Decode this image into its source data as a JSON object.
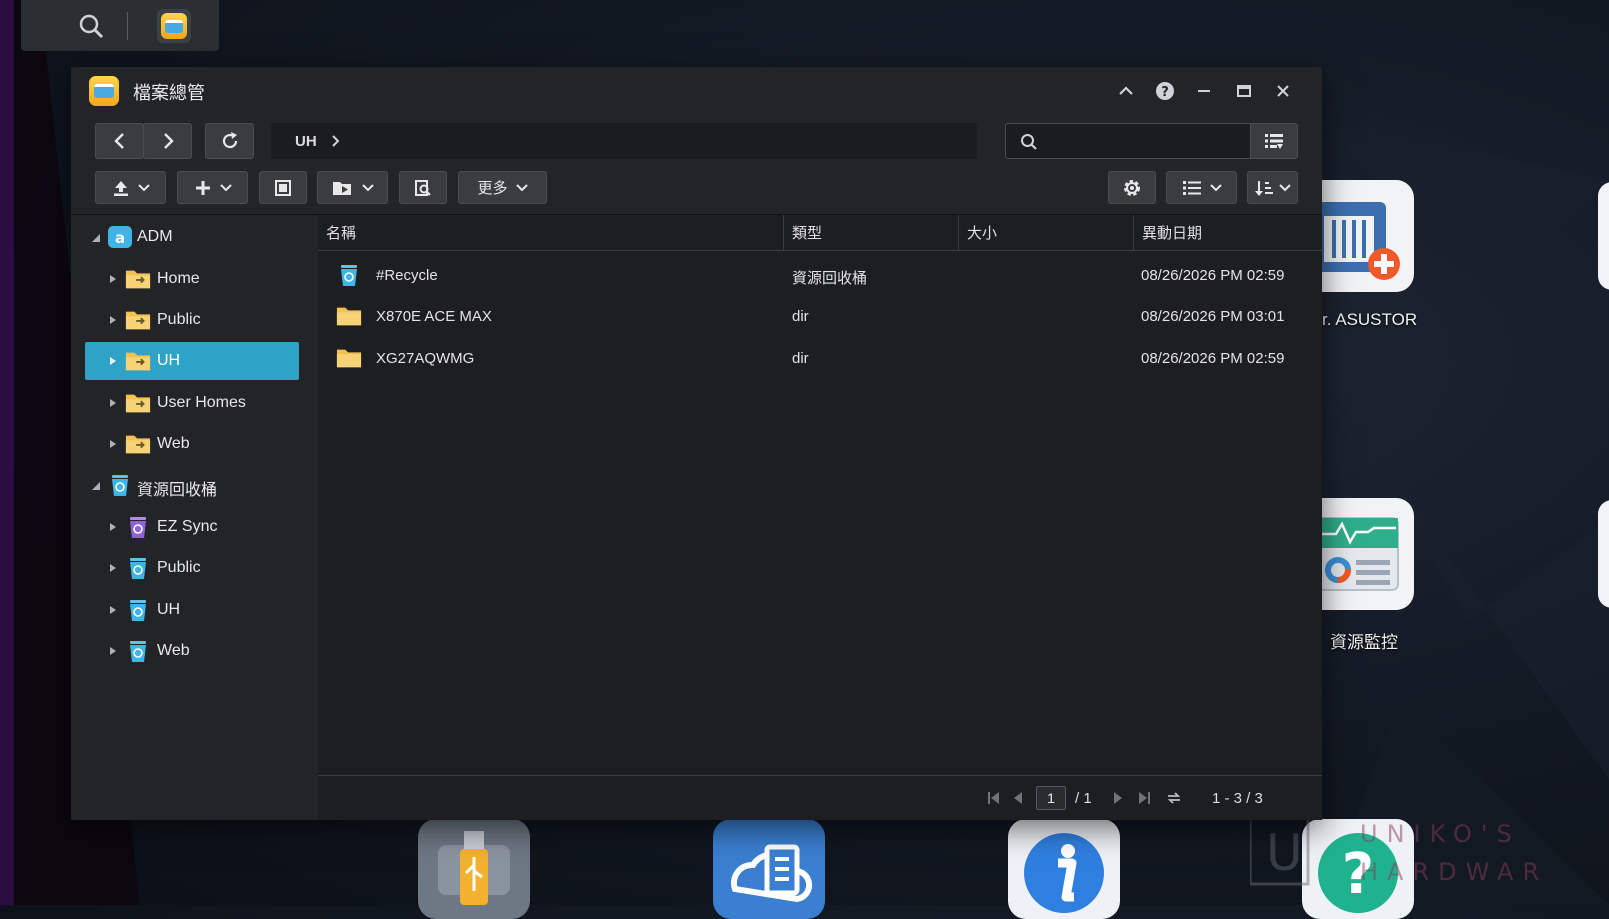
{
  "window": {
    "title": "檔案總管",
    "path": "UH"
  },
  "search": {
    "placeholder": ""
  },
  "toolbar": {
    "more_label": "更多"
  },
  "sidebar": {
    "groups": [
      {
        "label": "ADM",
        "items": [
          "Home",
          "Public",
          "UH",
          "User Homes",
          "Web"
        ]
      },
      {
        "label": "資源回收桶",
        "items": [
          "EZ Sync",
          "Public",
          "UH",
          "Web"
        ]
      }
    ],
    "selected": "UH"
  },
  "columns": {
    "name": "名稱",
    "type": "類型",
    "size": "大小",
    "modified": "異動日期"
  },
  "files": [
    {
      "name": "#Recycle",
      "type": "資源回收桶",
      "size": "",
      "modified": "08/26/2026 PM 02:59",
      "icon": "recycle-bin-icon"
    },
    {
      "name": "X870E ACE MAX",
      "type": "dir",
      "size": "",
      "modified": "08/26/2026 PM 03:01",
      "icon": "folder-icon"
    },
    {
      "name": "XG27AQWMG",
      "type": "dir",
      "size": "",
      "modified": "08/26/2026 PM 02:59",
      "icon": "folder-icon"
    }
  ],
  "pager": {
    "page": "1",
    "total_pages": "/ 1",
    "range": "1 - 3 / 3"
  },
  "desktop": {
    "icons": [
      {
        "label": "r. ASUSTOR",
        "icon": "asustor-backup-icon"
      },
      {
        "label": "資源監控",
        "icon": "resource-monitor-icon"
      }
    ],
    "watermark": "UNIKO'S HARDWARE"
  },
  "colors": {
    "accent": "#2fa3c6",
    "folder": "#f2c14e",
    "window_bg": "#232427"
  }
}
